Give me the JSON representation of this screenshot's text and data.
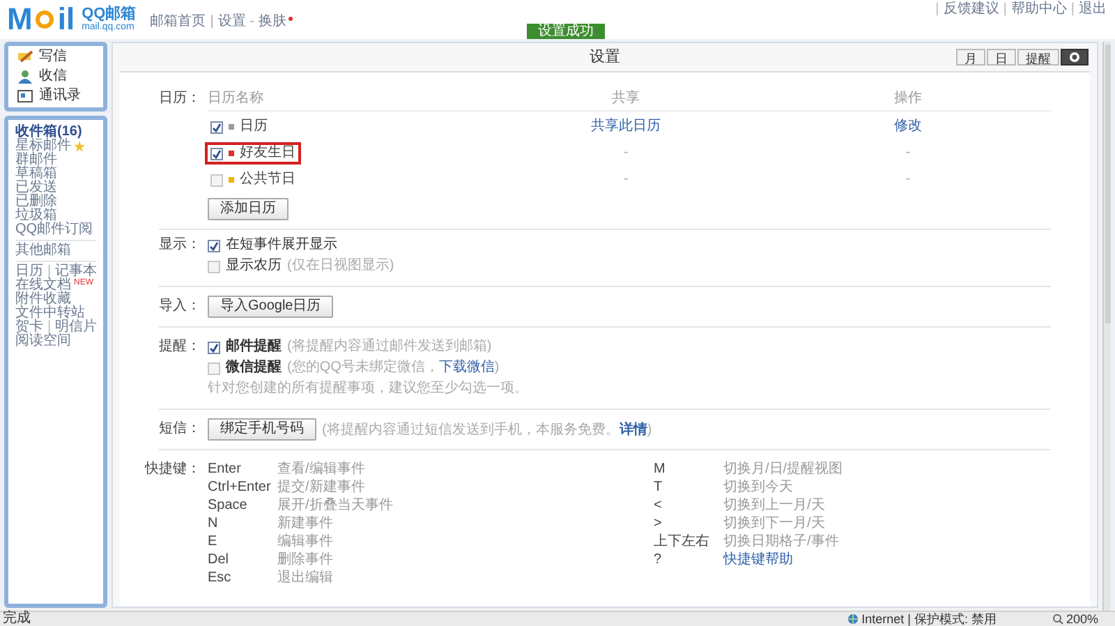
{
  "header": {
    "logo": {
      "left": "M",
      "right": "il",
      "brand": "QQ邮箱",
      "domain": "mail.qq.com"
    },
    "nav": [
      {
        "kind": "link",
        "text": "邮箱首页"
      },
      {
        "kind": "sep",
        "text": "|"
      },
      {
        "kind": "link",
        "text": "设置"
      },
      {
        "kind": "sep",
        "text": "-"
      },
      {
        "kind": "link",
        "text": "换肤",
        "dot": true
      }
    ],
    "notice": "设置成功",
    "top_links": [
      {
        "kind": "sep",
        "text": "|"
      },
      {
        "kind": "link",
        "text": "反馈建议"
      },
      {
        "kind": "sep",
        "text": "|"
      },
      {
        "kind": "link",
        "text": "帮助中心"
      },
      {
        "kind": "sep",
        "text": "|"
      },
      {
        "kind": "link",
        "text": "退出"
      }
    ]
  },
  "sidebar": {
    "actions": [
      {
        "label": "写信"
      },
      {
        "label": "收信"
      },
      {
        "label": "通讯录"
      }
    ],
    "groups": [
      [
        {
          "label": "收件箱(16)",
          "bold": true
        },
        {
          "label": "星标邮件",
          "star": true
        },
        {
          "label": "群邮件"
        },
        {
          "label": "草稿箱"
        },
        {
          "label": "已发送"
        },
        {
          "label": "已删除"
        },
        {
          "label": "垃圾箱"
        },
        {
          "label": "QQ邮件订阅"
        }
      ],
      [
        {
          "label": "其他邮箱"
        }
      ],
      [
        {
          "label": "日历",
          "separator": "|",
          "label2": "记事本"
        },
        {
          "label": "在线文档",
          "badge": "NEW"
        },
        {
          "label": "附件收藏"
        },
        {
          "label": "文件中转站"
        },
        {
          "label": "贺卡",
          "separator": "|",
          "label2": "明信片"
        },
        {
          "label": "阅读空间"
        }
      ]
    ]
  },
  "page": {
    "title": "设置",
    "view_tabs": [
      {
        "kind": "text",
        "label": "月",
        "selected": false
      },
      {
        "kind": "text",
        "label": "日",
        "selected": false
      },
      {
        "kind": "text",
        "label": "提醒",
        "selected": false
      },
      {
        "kind": "gear",
        "selected": true
      }
    ],
    "calendar": {
      "label": "日历：",
      "columns": [
        "日历名称",
        "共享",
        "操作"
      ],
      "rows": [
        {
          "name": "日历",
          "color": "#9a9a9a",
          "checked": true,
          "highlighted": false,
          "share": "共享此日历",
          "action": "修改"
        },
        {
          "name": "好友生日",
          "color": "#e03030",
          "checked": true,
          "highlighted": true,
          "share": "-",
          "action": "-"
        },
        {
          "name": "公共节日",
          "color": "#f0b400",
          "checked": false,
          "highlighted": false,
          "share": "-",
          "action": "-"
        }
      ],
      "add_button": "添加日历"
    },
    "display": {
      "label": "显示：",
      "options": [
        {
          "text": "在短事件展开显示",
          "checked": true
        },
        {
          "text": "显示农历",
          "hint": "(仅在日视图显示)",
          "checked": false
        }
      ]
    },
    "import": {
      "label": "导入：",
      "button": "导入Google日历"
    },
    "reminder": {
      "label": "提醒：",
      "options": [
        {
          "text": "邮件提醒",
          "hint": "(将提醒内容通过邮件发送到邮箱)",
          "checked": true
        },
        {
          "text": "微信提醒",
          "hint": "(您的QQ号未绑定微信，",
          "link": "下载微信",
          "hint_end": ")",
          "checked": false
        }
      ],
      "note": "针对您创建的所有提醒事项，建议您至少勾选一项。"
    },
    "sms": {
      "label": "短信：",
      "button": "绑定手机号码",
      "hint": "(将提醒内容通过短信发送到手机，本服务免费。",
      "link": "详情",
      "hint_end": ")"
    },
    "shortcuts": {
      "label": "快捷键：",
      "left": [
        {
          "key": "Enter",
          "desc": "查看/编辑事件"
        },
        {
          "key": "Ctrl+Enter",
          "desc": "提交/新建事件"
        },
        {
          "key": "Space",
          "desc": "展开/折叠当天事件"
        },
        {
          "key": "N",
          "desc": "新建事件"
        },
        {
          "key": "E",
          "desc": "编辑事件"
        },
        {
          "key": "Del",
          "desc": "删除事件"
        },
        {
          "key": "Esc",
          "desc": "退出编辑"
        }
      ],
      "right": [
        {
          "key": "M",
          "desc": "切换月/日/提醒视图"
        },
        {
          "key": "T",
          "desc": "切换到今天"
        },
        {
          "key": "<",
          "desc": "切换到上一月/天"
        },
        {
          "key": ">",
          "desc": "切换到下一月/天"
        },
        {
          "key": "上下左右",
          "desc": "切换日期格子/事件"
        },
        {
          "key": "?",
          "desc": "快捷键帮助",
          "link": true
        }
      ]
    }
  },
  "status_bar": {
    "left": "完成",
    "zone": "Internet | 保护模式: 禁用",
    "zoom": "200%"
  }
}
